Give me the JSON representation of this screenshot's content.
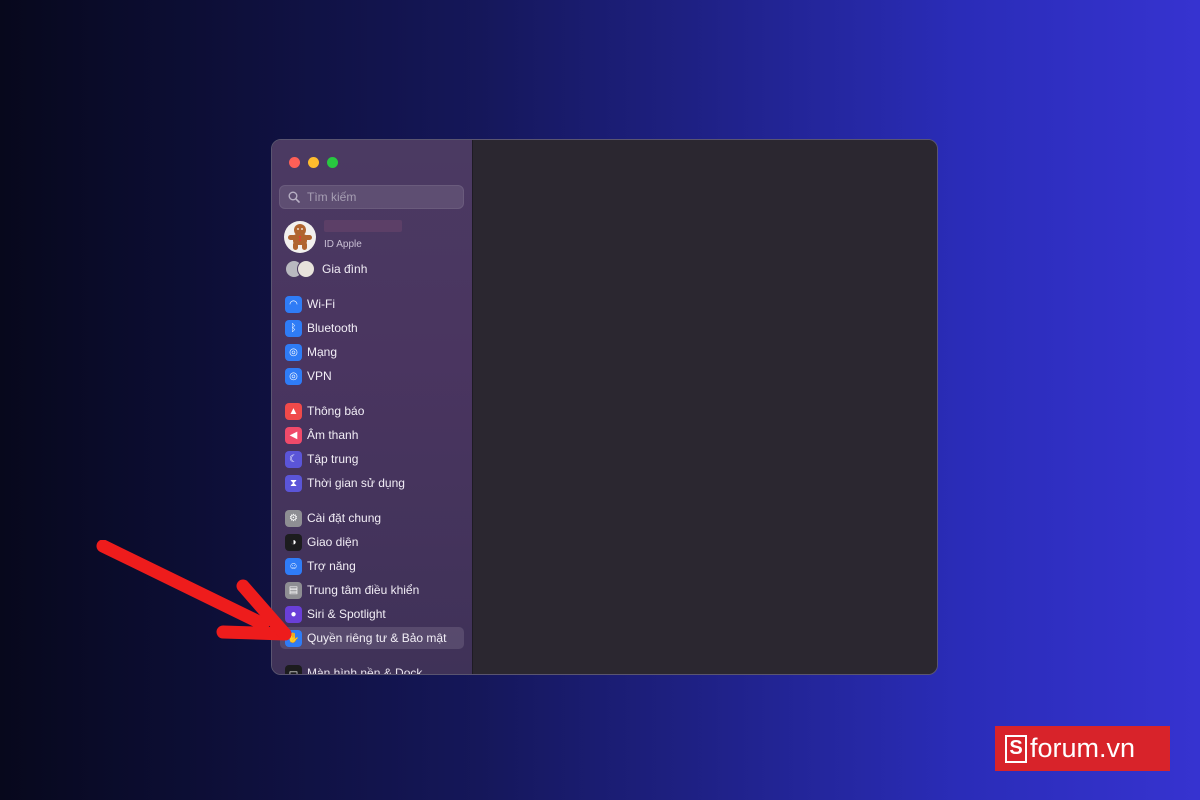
{
  "window": {
    "search": {
      "placeholder": "Tìm kiếm"
    }
  },
  "profile": {
    "subtitle": "ID Apple"
  },
  "family": {
    "label": "Gia đình"
  },
  "sidebar": {
    "items": [
      {
        "label": "Wi-Fi",
        "icon": "wifi-icon",
        "color": "#2f7cf6"
      },
      {
        "label": "Bluetooth",
        "icon": "bluetooth-icon",
        "color": "#2f7cf6"
      },
      {
        "label": "Mạng",
        "icon": "globe-icon",
        "color": "#2f7cf6"
      },
      {
        "label": "VPN",
        "icon": "vpn-globe-icon",
        "color": "#2f7cf6"
      },
      {
        "label": "Thông báo",
        "icon": "bell-icon",
        "color": "#f04a4a"
      },
      {
        "label": "Âm thanh",
        "icon": "speaker-icon",
        "color": "#f04a6a"
      },
      {
        "label": "Tập trung",
        "icon": "moon-icon",
        "color": "#5b55d8"
      },
      {
        "label": "Thời gian sử dụng",
        "icon": "hourglass-icon",
        "color": "#5b55d8"
      },
      {
        "label": "Cài đặt chung",
        "icon": "gear-icon",
        "color": "#8e8e93"
      },
      {
        "label": "Giao diện",
        "icon": "appearance-icon",
        "color": "#1c1c1e"
      },
      {
        "label": "Trợ năng",
        "icon": "accessibility-icon",
        "color": "#2f7cf6"
      },
      {
        "label": "Trung tâm điều khiển",
        "icon": "control-center-icon",
        "color": "#8e8e93"
      },
      {
        "label": "Siri & Spotlight",
        "icon": "siri-icon",
        "color": "#6a3fd8"
      },
      {
        "label": "Quyền riêng tư & Bảo mật",
        "icon": "hand-icon",
        "color": "#2f7cf6",
        "selected": true
      },
      {
        "label": "Màn hình nền & Dock",
        "icon": "dock-icon",
        "color": "#1c1c1e"
      }
    ]
  },
  "watermark": {
    "letter": "S",
    "text": "forum.vn",
    "color": "#d8232a"
  },
  "annotation": {
    "arrow_color": "#ee1c1c"
  }
}
